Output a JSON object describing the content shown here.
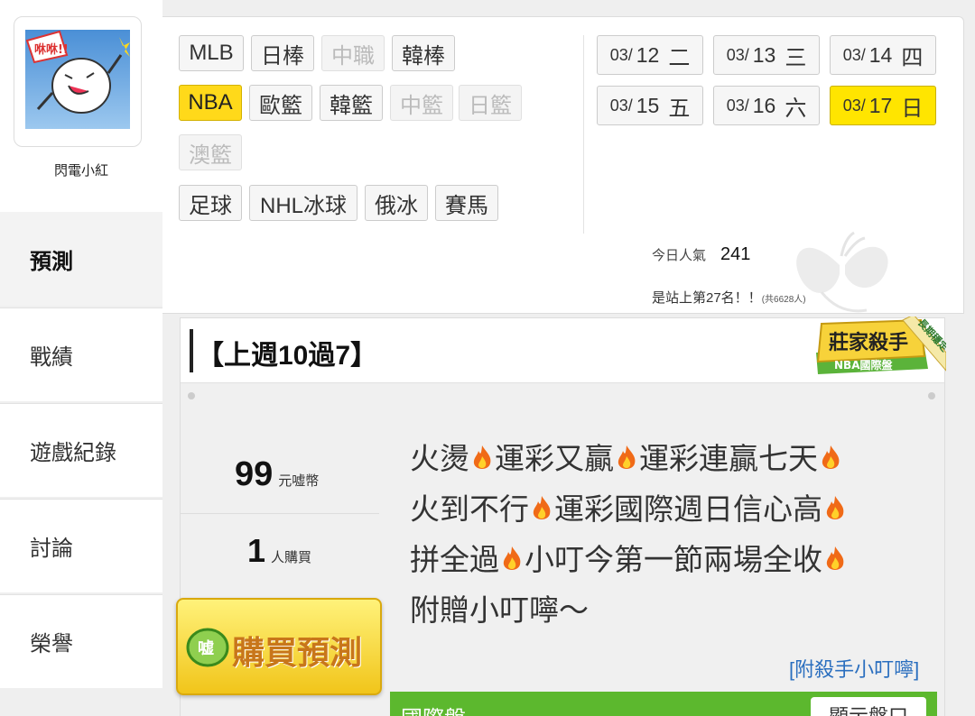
{
  "profile": {
    "name": "閃電小紅"
  },
  "nav": [
    {
      "label": "預測",
      "active": true
    },
    {
      "label": "戰績",
      "active": false
    },
    {
      "label": "遊戲紀錄",
      "active": false
    },
    {
      "label": "討論",
      "active": false
    },
    {
      "label": "榮譽",
      "active": false
    }
  ],
  "leagues": [
    {
      "label": "MLB",
      "state": "normal"
    },
    {
      "label": "日棒",
      "state": "normal"
    },
    {
      "label": "中職",
      "state": "disabled"
    },
    {
      "label": "韓棒",
      "state": "normal"
    },
    {
      "label": "NBA",
      "state": "active"
    },
    {
      "label": "歐籃",
      "state": "normal"
    },
    {
      "label": "韓籃",
      "state": "normal"
    },
    {
      "label": "中籃",
      "state": "disabled"
    },
    {
      "label": "日籃",
      "state": "disabled"
    },
    {
      "label": "澳籃",
      "state": "disabled"
    },
    {
      "label": "足球",
      "state": "normal"
    },
    {
      "label": "NHL冰球",
      "state": "normal"
    },
    {
      "label": "俄冰",
      "state": "normal"
    },
    {
      "label": "賽馬",
      "state": "normal"
    }
  ],
  "dates": [
    {
      "month": "03/",
      "day": "12",
      "weekday": "二",
      "active": false
    },
    {
      "month": "03/",
      "day": "13",
      "weekday": "三",
      "active": false
    },
    {
      "month": "03/",
      "day": "14",
      "weekday": "四",
      "active": false
    },
    {
      "month": "03/",
      "day": "15",
      "weekday": "五",
      "active": false
    },
    {
      "month": "03/",
      "day": "16",
      "weekday": "六",
      "active": false
    },
    {
      "month": "03/",
      "day": "17",
      "weekday": "日",
      "active": true
    }
  ],
  "stats": {
    "popularity_label": "今日人氣",
    "popularity_value": "241",
    "rank_text": "是站上第27名！！",
    "rank_total": "(共6628人)"
  },
  "card": {
    "title": "【上週10過7】",
    "badge_title": "莊家殺手",
    "badge_sub": "NBA國際盤",
    "badge_ribbon": "長期穩定",
    "price_value": "99",
    "price_unit": "元嘘幣",
    "buyers_value": "1",
    "buyers_unit": "人購買",
    "message_lines": [
      [
        "火燙",
        "運彩又贏",
        "運彩連贏七天",
        ""
      ],
      [
        "火到不行",
        "運彩國際週日信心高",
        ""
      ],
      [
        "拼全過",
        "小叮今第一節兩場全收",
        ""
      ],
      [
        "附贈小叮嚀～"
      ]
    ],
    "kill_link": "[附殺手小叮嚀]",
    "green_bar_label": "國際盤",
    "show_odds_button": "顯示盤口",
    "buy_button": "購買預測",
    "coin_text": "嘘"
  },
  "colors": {
    "accent_yellow": "#ffd91a",
    "green": "#5cb82e",
    "link_blue": "#2b6fbf"
  }
}
